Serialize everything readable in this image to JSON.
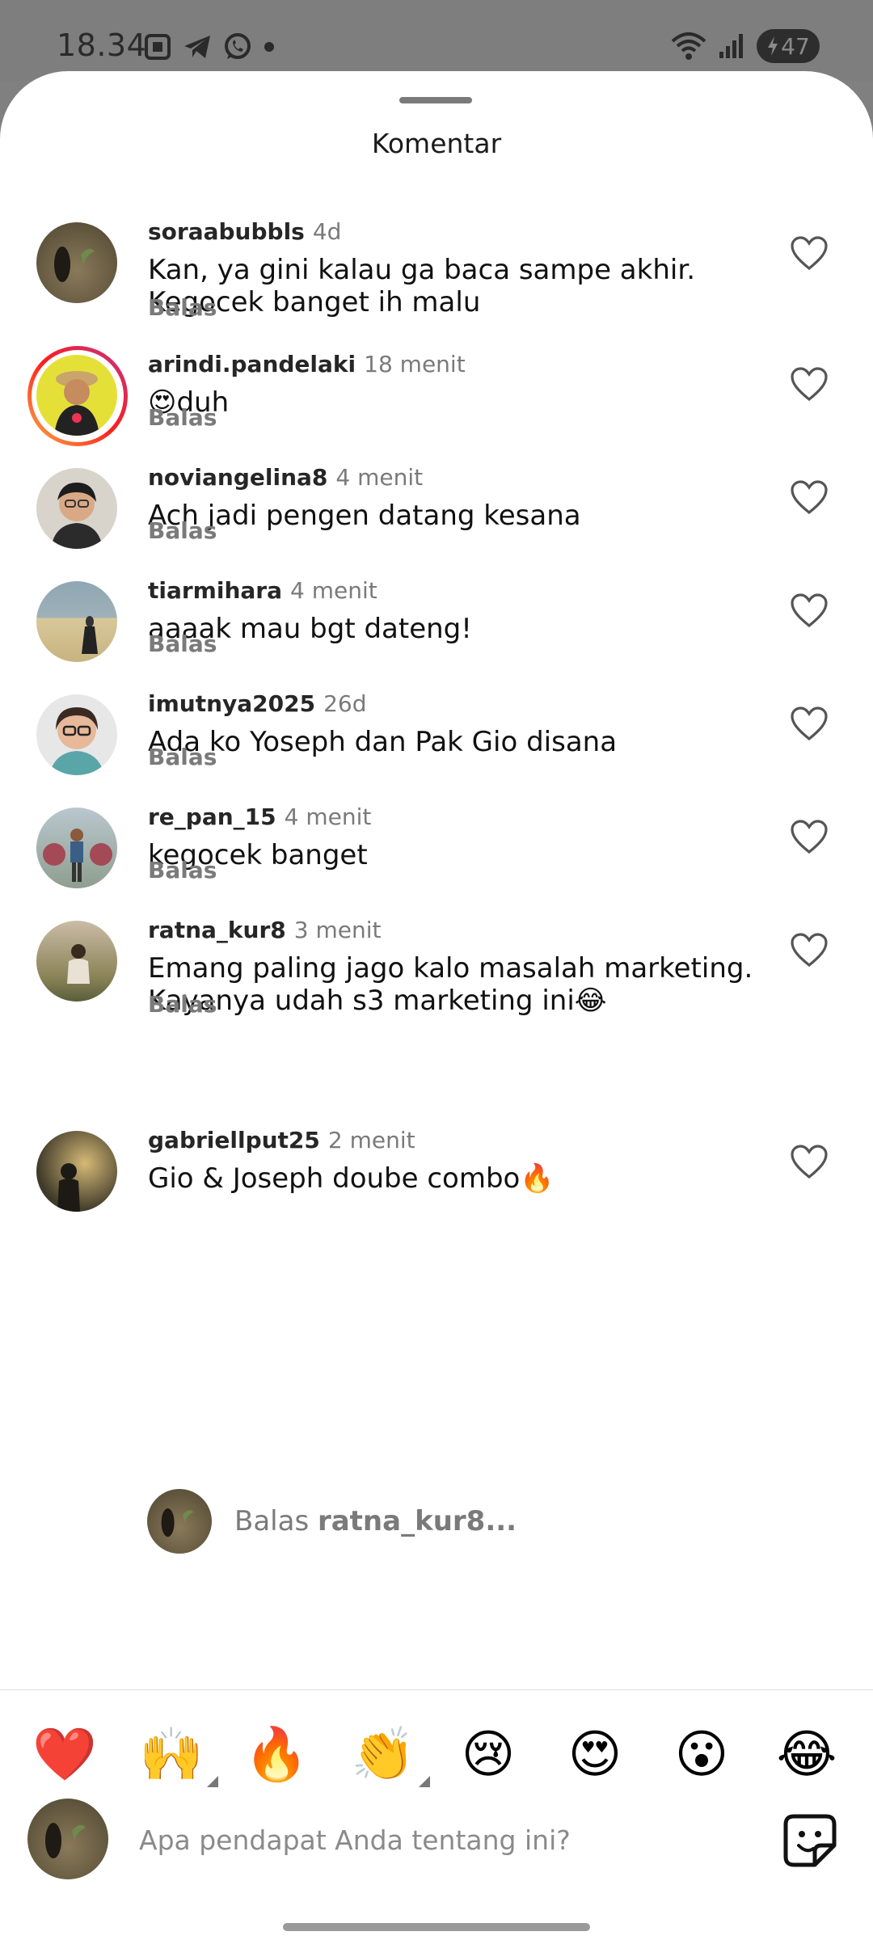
{
  "status_bar": {
    "time": "18.34",
    "battery": "47"
  },
  "sheet_title": "Komentar",
  "reply_label": "Balas",
  "comments": [
    {
      "username": "soraabubbls",
      "time": "4d",
      "text": "Kan, ya gini kalau ga baca sampe akhir. Kegocek banget ih malu"
    },
    {
      "username": "arindi.pandelaki",
      "time": "18 menit",
      "text": "😍duh"
    },
    {
      "username": "noviangelina8",
      "time": "4 menit",
      "text": "Ach jadi pengen datang kesana"
    },
    {
      "username": "tiarmihara",
      "time": "4 menit",
      "text": "aaaak mau bgt dateng!"
    },
    {
      "username": "imutnya2025",
      "time": "26d",
      "text": "Ada ko Yoseph dan Pak Gio disana"
    },
    {
      "username": "re_pan_15",
      "time": "4 menit",
      "text": "kegocek banget"
    },
    {
      "username": "ratna_kur8",
      "time": "3 menit",
      "text": "Emang paling jago kalo masalah marketing. Kayanya udah s3 marketing ini😂"
    },
    {
      "username": "gabriellput25",
      "time": "2 menit",
      "text": "Gio & Joseph doube combo🔥"
    }
  ],
  "reply_prompt": {
    "prefix": "Balas",
    "target": "ratna_kur8..."
  },
  "emojis": [
    "❤️",
    "🙌",
    "🔥",
    "👏",
    "😢",
    "😍",
    "😮",
    "😂"
  ],
  "input_placeholder": "Apa pendapat Anda tentang ini?"
}
